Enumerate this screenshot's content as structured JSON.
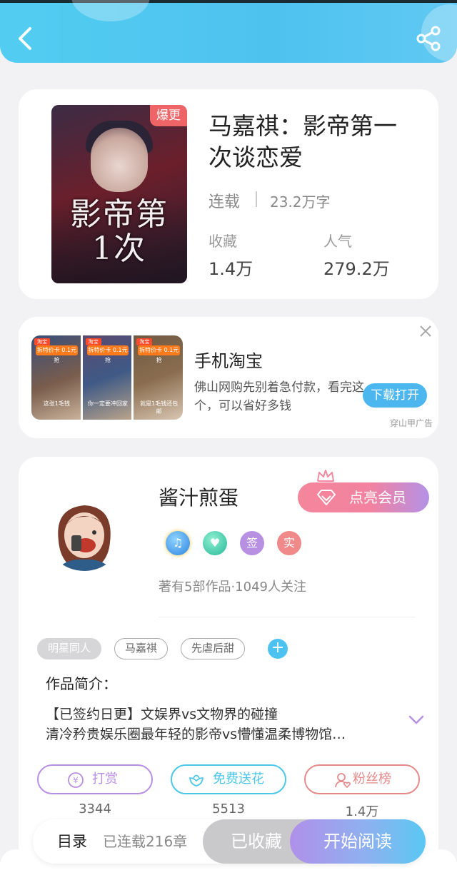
{
  "book": {
    "badge": "爆更",
    "title": "马嘉祺：影帝第一次谈恋爱",
    "status": "连载",
    "word_count": "23.2万字",
    "favorites_label": "收藏",
    "favorites_value": "1.4万",
    "popularity_label": "人气",
    "popularity_value": "279.2万",
    "cover_art_text": "影帝第1次"
  },
  "ad": {
    "title": "手机淘宝",
    "description": "佛山网购先别着急付款，看完这个，可以省好多钱",
    "button": "下载打开",
    "source": "穿山甲广告",
    "image_tag": "拆特价卡 0.1元抢",
    "image_tag_small": "淘宝",
    "captions": [
      "这张1毛钱",
      "你一定要冲回家",
      "就是1毛钱还包邮"
    ]
  },
  "author": {
    "name": "酱汁煎蛋",
    "vip_button": "点亮会员",
    "badges": [
      "签",
      "实"
    ],
    "works_info": "著有5部作品·1049人关注"
  },
  "tags": [
    "明星同人",
    "马嘉祺",
    "先虐后甜"
  ],
  "intro": {
    "label": "作品简介：",
    "line1": "【已签约日更】文娱界vs文物界的碰撞",
    "line2": "清冷矜贵娱乐圈最年轻的影帝vs懵懂温柔博物馆…"
  },
  "actions": [
    {
      "label": "打赏",
      "count": "3344"
    },
    {
      "label": "免费送花",
      "count": "5513"
    },
    {
      "label": "粉丝榜",
      "count": "1.4万"
    }
  ],
  "bottom_bar": {
    "toc": "目录",
    "chapters": "已连载216章",
    "favorited": "已收藏",
    "start_reading": "开始阅读"
  },
  "colors": {
    "header": "#52cdf1",
    "hot_badge": "#ef6567",
    "tip_purple": "#b890e2",
    "flower_teal": "#4cc7e6",
    "fans_red": "#e58a8a"
  }
}
